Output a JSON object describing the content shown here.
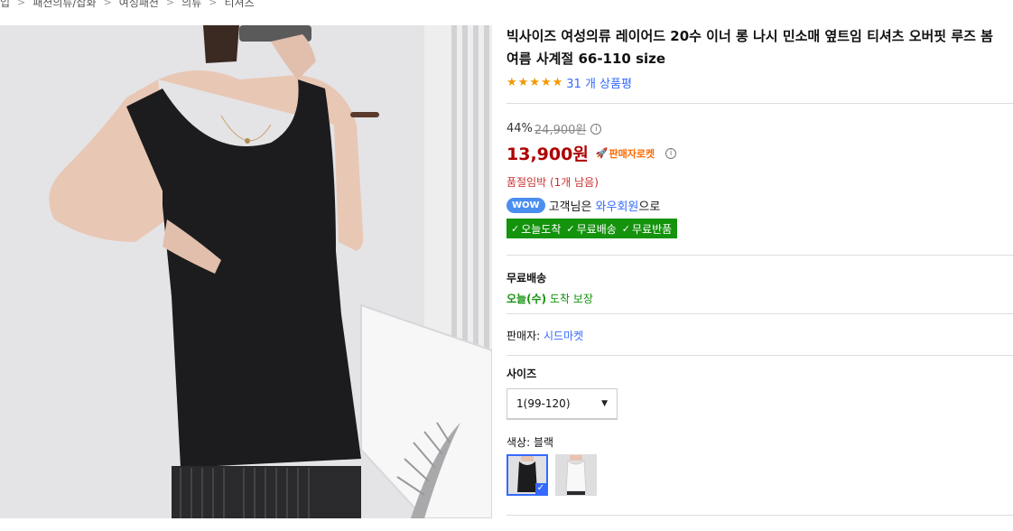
{
  "breadcrumb": [
    "입",
    "패션의류/잡화",
    "여성패션",
    "의류",
    "티셔츠"
  ],
  "product": {
    "title": "빅사이즈 여성의류 레이어드 20수 이너 롱 나시 민소매 옆트임 티셔츠 오버핏 루즈 봄 여름 사계절 66-110 size",
    "rating_stars": 5,
    "review_count": "31 개 상품평"
  },
  "price": {
    "discount_rate": "44%",
    "original_price": "24,900원",
    "sale_price": "13,900원",
    "rocket_label": "판매자로켓",
    "stock_notice": "품절임박 (1개 남음)"
  },
  "wow": {
    "badge": "WOW",
    "prefix": "고객님은 ",
    "link": "와우회원",
    "suffix": "으로"
  },
  "benefits": [
    "오늘도착",
    "무료배송",
    "무료반품"
  ],
  "shipping": {
    "title": "무료배송",
    "day": "오늘(수)",
    "rest": " 도착 보장"
  },
  "seller": {
    "label": "판매자: ",
    "name": "시드마켓"
  },
  "size": {
    "label": "사이즈",
    "selected": "1(99-120)"
  },
  "color": {
    "label": "색상: 블랙"
  },
  "colors": {
    "price_red": "#ae0000",
    "link_blue": "#346aff",
    "rocket_green": "#14930d",
    "star_orange": "#f39800"
  }
}
